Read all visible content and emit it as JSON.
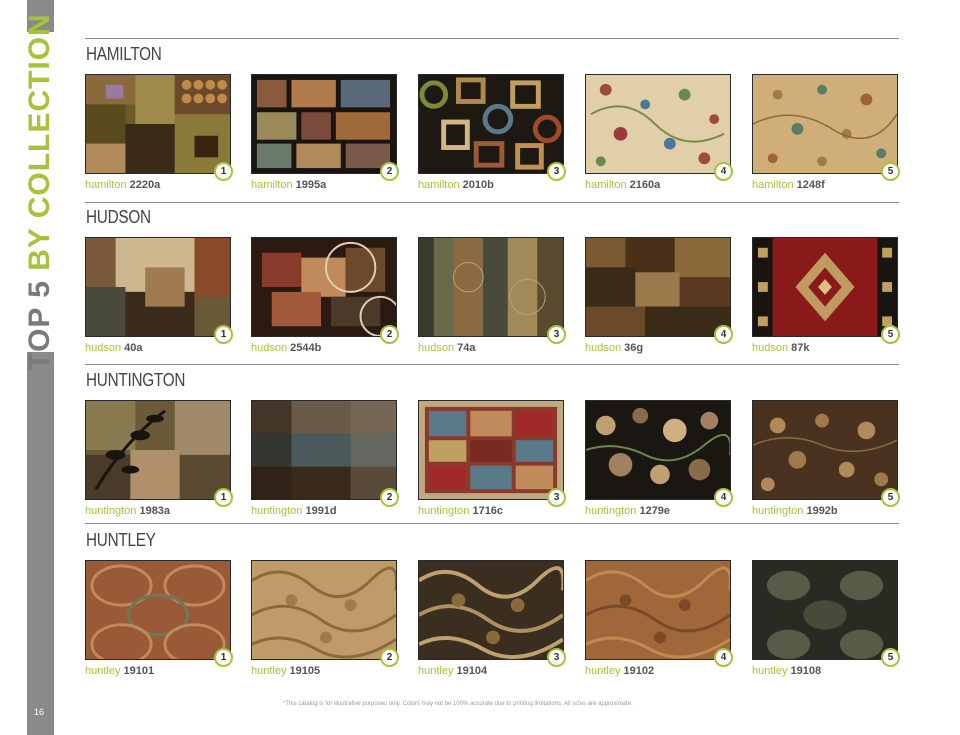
{
  "sidebar": {
    "title_part1": "TOP 5",
    "title_part2": "BY COLLECTION",
    "page_number": "16"
  },
  "sections": [
    {
      "title": "HAMILTON",
      "items": [
        {
          "collection": "hamilton",
          "code": "2220a",
          "rank": "1"
        },
        {
          "collection": "hamilton",
          "code": "1995a",
          "rank": "2"
        },
        {
          "collection": "hamilton",
          "code": "2010b",
          "rank": "3"
        },
        {
          "collection": "hamilton",
          "code": "2160a",
          "rank": "4"
        },
        {
          "collection": "hamilton",
          "code": "1248f",
          "rank": "5"
        }
      ]
    },
    {
      "title": "HUDSON",
      "items": [
        {
          "collection": "hudson",
          "code": "40a",
          "rank": "1"
        },
        {
          "collection": "hudson",
          "code": "2544b",
          "rank": "2"
        },
        {
          "collection": "hudson",
          "code": "74a",
          "rank": "3"
        },
        {
          "collection": "hudson",
          "code": "36g",
          "rank": "4"
        },
        {
          "collection": "hudson",
          "code": "87k",
          "rank": "5"
        }
      ]
    },
    {
      "title": "HUNTINGTON",
      "items": [
        {
          "collection": "huntington",
          "code": "1983a",
          "rank": "1"
        },
        {
          "collection": "huntington",
          "code": "1991d",
          "rank": "2"
        },
        {
          "collection": "huntington",
          "code": "1716c",
          "rank": "3"
        },
        {
          "collection": "huntington",
          "code": "1279e",
          "rank": "4"
        },
        {
          "collection": "huntington",
          "code": "1992b",
          "rank": "5"
        }
      ]
    },
    {
      "title": "HUNTLEY",
      "items": [
        {
          "collection": "huntley",
          "code": "19101",
          "rank": "1"
        },
        {
          "collection": "huntley",
          "code": "19105",
          "rank": "2"
        },
        {
          "collection": "huntley",
          "code": "19104",
          "rank": "3"
        },
        {
          "collection": "huntley",
          "code": "19102",
          "rank": "4"
        },
        {
          "collection": "huntley",
          "code": "19108",
          "rank": "5"
        }
      ]
    }
  ],
  "footnote": "*This catalog is for illustrative purposes only. Colors may not be 100% accurate due to printing limitations. All sizes are approximate.",
  "colors": {
    "accent_green": "#a6c33c",
    "sidebar_gray": "#8a8a8a",
    "heading_gray": "#444444"
  }
}
